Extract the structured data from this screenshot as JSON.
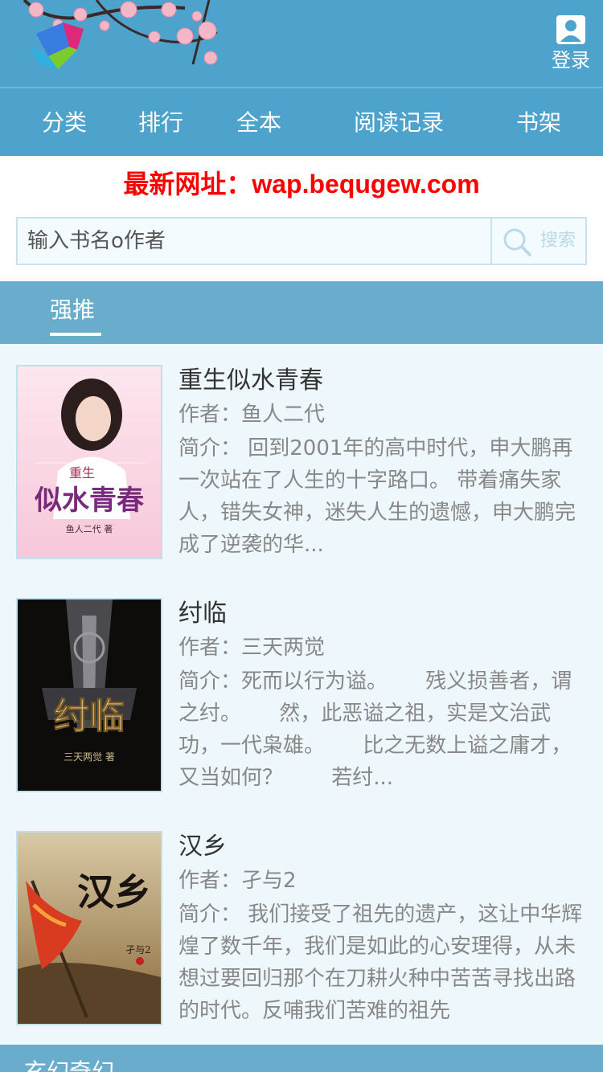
{
  "header": {
    "login_label": "登录"
  },
  "nav": {
    "items": [
      "分类",
      "排行",
      "全本",
      "阅读记录",
      "书架"
    ]
  },
  "notice": "最新网址：wap.bequgew.com",
  "search": {
    "placeholder": "输入书名o作者",
    "button_label": "搜索"
  },
  "section": {
    "tab_label": "强推"
  },
  "books": [
    {
      "title": "重生似水青春",
      "author": "作者：鱼人二代",
      "desc": "简介： 回到2001年的高中时代，申大鹏再一次站在了人生的十字路口。 带着痛失家人，错失女神，迷失人生的遗憾，申大鹏完成了逆袭的华...",
      "cover_text": "似水青春",
      "cover_sub": "重生",
      "cover_author": "鱼人二代 著"
    },
    {
      "title": "纣临",
      "author": "作者：三天两觉",
      "desc": "简介：死而以行为谥。　　 残义损善者，谓之纣。　　 然，此恶谥之祖，实是文治武功，一代枭雄。　　 比之无数上谥之庸才，又当如何？　　 若纣...",
      "cover_text": "纣临",
      "cover_author": "三天两觉 著"
    },
    {
      "title": "汉乡",
      "author": "作者：孑与2",
      "desc": "简介： 我们接受了祖先的遗产，这让中华辉煌了数千年，我们是如此的心安理得，从未想过要回归那个在刀耕火种中苦苦寻找出路的时代。反哺我们苦难的祖先",
      "cover_text": "汉乡",
      "cover_author": "孑与2"
    }
  ],
  "bottom_section_label": "玄幻奇幻",
  "colors": {
    "header_bg": "#4ea3cc",
    "notice_red": "#ff0000",
    "section_bg": "#6aaccb",
    "page_bg": "#eef7fb"
  }
}
